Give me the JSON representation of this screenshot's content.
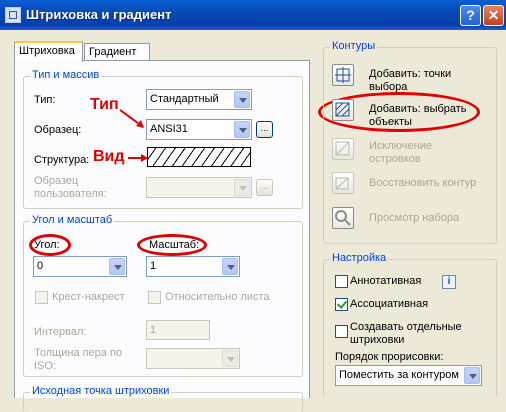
{
  "window": {
    "title": "Штриховка и градиент",
    "help_label": "?",
    "close_label": "✕"
  },
  "tabs": [
    {
      "label": "Штриховка"
    },
    {
      "label": "Градиент"
    }
  ],
  "type_pattern": {
    "group_label": "Тип и массив",
    "type_label": "Тип:",
    "type_value": "Стандартный",
    "pattern_label": "Образец:",
    "pattern_value": "ANSI31",
    "pattern_browse": "...",
    "swatch_label": "Структура:",
    "custom_label_1": "Образец",
    "custom_label_2": "пользователя:",
    "custom_browse": "..."
  },
  "annotations": {
    "type_note": "Тип",
    "view_note": "Вид"
  },
  "angle_scale": {
    "group_label": "Угол и масштаб",
    "angle_label": "Угол:",
    "angle_value": "0",
    "scale_label": "Масштаб:",
    "scale_value": "1",
    "double_label": "Крест-накрест",
    "relative_label": "Относительно листа",
    "spacing_label": "Интервал:",
    "spacing_value": "1",
    "pen_label_1": "Толщина пера по",
    "pen_label_2": "ISO:"
  },
  "origin": {
    "group_label": "Исходная точка штриховки"
  },
  "boundaries": {
    "group_label": "Контуры",
    "add_pick": {
      "line1": "Добавить: точки",
      "line2": "выбора"
    },
    "add_select": {
      "line1": "Добавить: выбрать",
      "line2": "объекты"
    },
    "remove_islands": {
      "line1": "Исключение",
      "line2": "островков"
    },
    "recreate": "Восстановить контур",
    "view_selections": "Просмотр набора"
  },
  "options": {
    "group_label": "Настройка",
    "annotative_label": "Аннотативная",
    "annotative_checked": false,
    "info_label": "i",
    "associative_label": "Ассоциативная",
    "associative_checked": true,
    "separate_line1": "Создавать отдельные",
    "separate_line2": "штриховки",
    "separate_checked": false,
    "draw_order_label": "Порядок прорисовки:",
    "draw_order_value": "Поместить за контуром"
  },
  "colors": {
    "accent": "#0046d5",
    "annotation": "#e10000",
    "titlebar": "#0848b6"
  }
}
